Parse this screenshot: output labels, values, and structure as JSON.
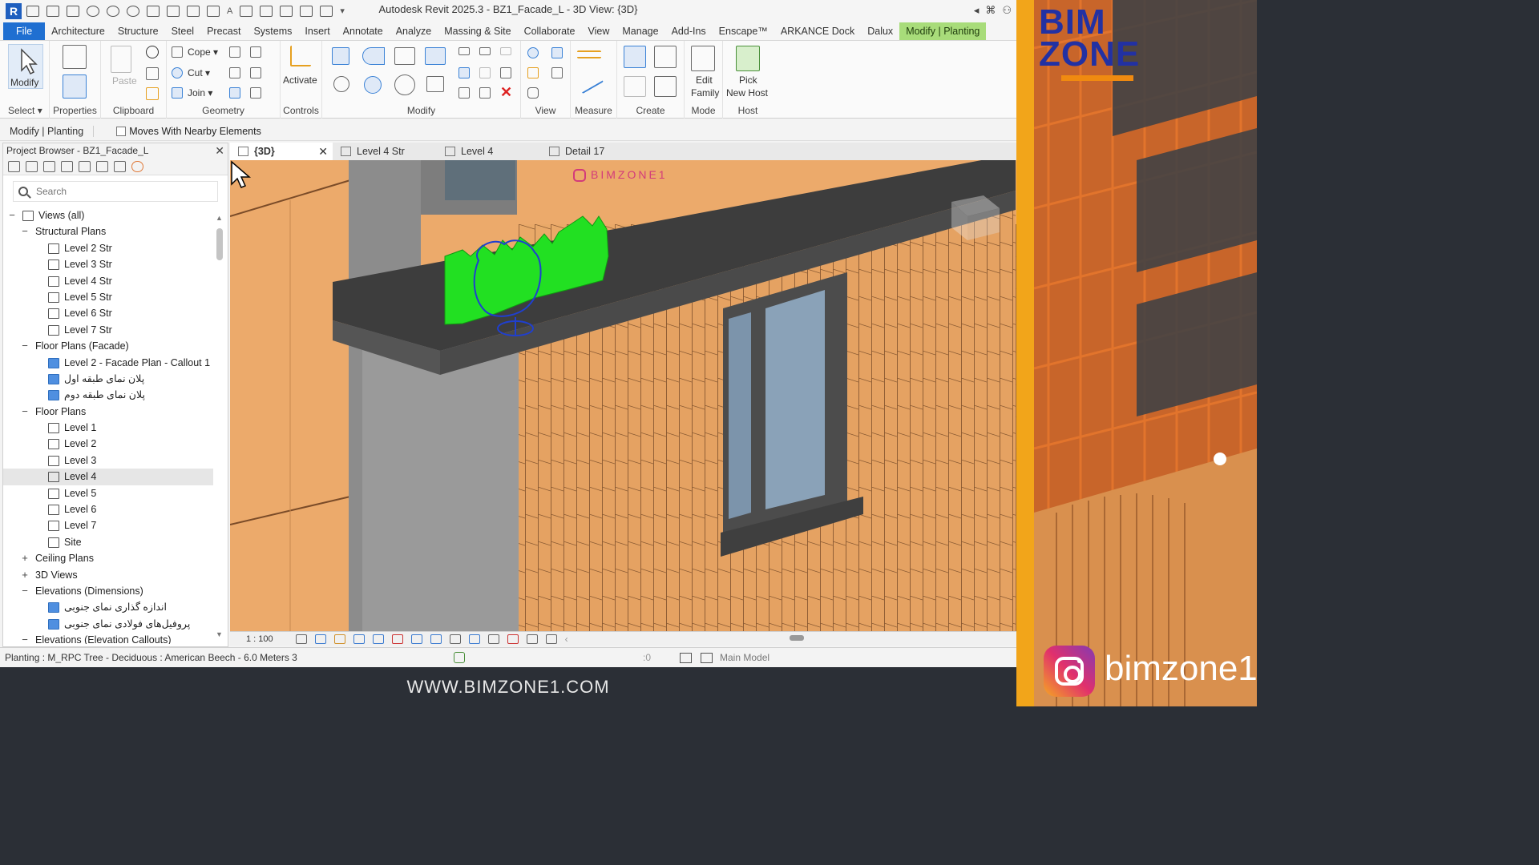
{
  "window": {
    "title": "Autodesk Revit 2025.3 - BZ1_Facade_L - 3D View: {3D}",
    "logo_letter": "R"
  },
  "menu": {
    "file": "File",
    "tabs": [
      "Architecture",
      "Structure",
      "Steel",
      "Precast",
      "Systems",
      "Insert",
      "Annotate",
      "Analyze",
      "Massing & Site",
      "Collaborate",
      "View",
      "Manage",
      "Add-Ins",
      "Enscape™",
      "ARKANCE Dock",
      "Dalux"
    ],
    "active_tab": "Modify | Planting"
  },
  "ribbon": {
    "modify": "Modify",
    "panels": {
      "select": "Select",
      "properties": "Properties",
      "clipboard": "Clipboard",
      "geometry": "Geometry",
      "controls": "Controls",
      "modify": "Modify",
      "view": "View",
      "measure": "Measure",
      "create": "Create",
      "mode": "Mode",
      "host": "Host"
    },
    "paste": "Paste",
    "cope": "Cope",
    "cut": "Cut",
    "join": "Join",
    "activate": "Activate",
    "edit_family": [
      "Edit",
      "Family"
    ],
    "pick_new_host": [
      "Pick",
      "New Host"
    ]
  },
  "options_bar": {
    "context": "Modify | Planting",
    "checkbox_label": "Moves With Nearby Elements",
    "checkbox_checked": false
  },
  "project_browser": {
    "title": "Project Browser - BZ1_Facade_L",
    "search_placeholder": "Search",
    "tree": [
      {
        "label": "Views (all)",
        "level": 0,
        "toggle": "−",
        "icon": "views"
      },
      {
        "label": "Structural Plans",
        "level": 1,
        "toggle": "−"
      },
      {
        "label": "Level 2 Str",
        "level": 2,
        "icon": "plan"
      },
      {
        "label": "Level 3 Str",
        "level": 2,
        "icon": "plan"
      },
      {
        "label": "Level 4 Str",
        "level": 2,
        "icon": "plan"
      },
      {
        "label": "Level 5 Str",
        "level": 2,
        "icon": "plan"
      },
      {
        "label": "Level 6 Str",
        "level": 2,
        "icon": "plan"
      },
      {
        "label": "Level 7 Str",
        "level": 2,
        "icon": "plan"
      },
      {
        "label": "Floor Plans (Facade)",
        "level": 1,
        "toggle": "−"
      },
      {
        "label": "Level 2 - Facade Plan - Callout 1",
        "level": 2,
        "icon": "blue"
      },
      {
        "label": "پلان نمای طبقه اول",
        "level": 2,
        "icon": "blue"
      },
      {
        "label": "پلان نمای طبقه دوم",
        "level": 2,
        "icon": "blue"
      },
      {
        "label": "Floor Plans",
        "level": 1,
        "toggle": "−"
      },
      {
        "label": "Level 1",
        "level": 2,
        "icon": "plan"
      },
      {
        "label": "Level 2",
        "level": 2,
        "icon": "plan"
      },
      {
        "label": "Level 3",
        "level": 2,
        "icon": "plan"
      },
      {
        "label": "Level 4",
        "level": 2,
        "icon": "plan",
        "selected": true
      },
      {
        "label": "Level 5",
        "level": 2,
        "icon": "plan"
      },
      {
        "label": "Level 6",
        "level": 2,
        "icon": "plan"
      },
      {
        "label": "Level 7",
        "level": 2,
        "icon": "plan"
      },
      {
        "label": "Site",
        "level": 2,
        "icon": "plan"
      },
      {
        "label": "Ceiling Plans",
        "level": 1,
        "toggle": "+"
      },
      {
        "label": "3D Views",
        "level": 1,
        "toggle": "+"
      },
      {
        "label": "Elevations (Dimensions)",
        "level": 1,
        "toggle": "−"
      },
      {
        "label": "اندازه گذاری نمای جنوبی",
        "level": 2,
        "icon": "blue"
      },
      {
        "label": "پروفیل‌های فولادی نمای جنوبی",
        "level": 2,
        "icon": "blue"
      },
      {
        "label": "Elevations (Elevation Callouts)",
        "level": 1,
        "toggle": "−"
      }
    ]
  },
  "view_tabs": [
    {
      "label": "{3D}",
      "active": true,
      "closable": true
    },
    {
      "label": "Level 4 Str",
      "active": false
    },
    {
      "label": "Level 4",
      "active": false
    },
    {
      "label": "Detail 17",
      "active": false
    }
  ],
  "viewport": {
    "watermark": "BIMZONE1",
    "scale": "1 : 100"
  },
  "status_bar": {
    "text": "Planting : M_RPC Tree - Deciduous : American Beech - 6.0 Meters 3",
    "zero": ":0",
    "model": "Main Model"
  },
  "promo": {
    "logo_line1": "BIM",
    "logo_line2": "ZONE",
    "instagram_handle": "bimzone1",
    "website": "WWW.BIMZONE1.COM"
  },
  "colors": {
    "file_tab": "#1f6fd1",
    "active_tab": "#a8dc7a",
    "brick": "#e8a764",
    "plant": "#22e022",
    "brand_blue": "#2231a3",
    "brand_orange": "#f08a10"
  }
}
